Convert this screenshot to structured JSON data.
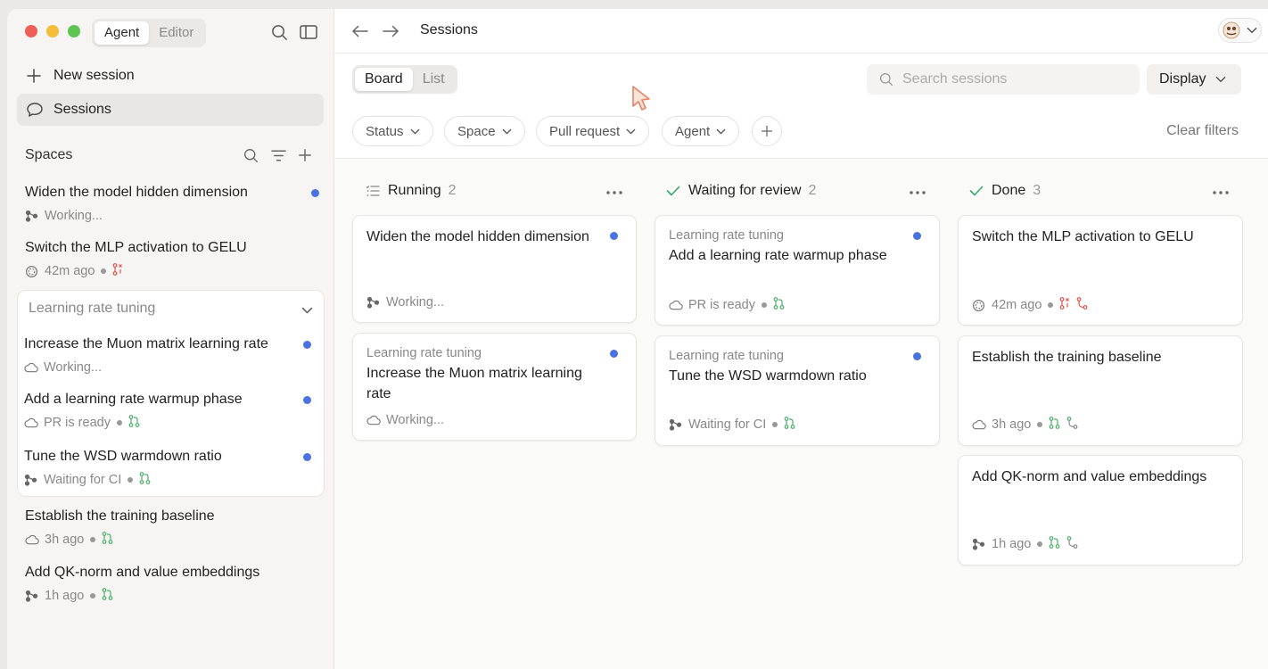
{
  "window": {
    "toggle": {
      "agent": "Agent",
      "editor": "Editor"
    }
  },
  "sidebar": {
    "new_session": "New session",
    "sessions": "Sessions",
    "spaces_title": "Spaces",
    "items_top": [
      {
        "title": "Widen the model hidden dimension",
        "meta": "Working...",
        "icon": "branch-icon",
        "unread": true
      },
      {
        "title": "Switch the MLP activation to GELU",
        "meta": "42m ago",
        "icon": "spinner-icon",
        "unread": false
      }
    ],
    "group": {
      "name": "Learning rate tuning",
      "items": [
        {
          "title": "Increase the Muon matrix learning rate",
          "meta": "Working...",
          "icon": "cloud-icon",
          "unread": true
        },
        {
          "title": "Add a learning rate warmup phase",
          "meta": "PR is ready",
          "icon": "cloud-icon",
          "unread": true
        },
        {
          "title": "Tune the WSD warmdown ratio",
          "meta": "Waiting for CI",
          "icon": "branch-icon",
          "unread": true
        }
      ]
    },
    "items_bottom": [
      {
        "title": "Establish the training baseline",
        "meta": "3h ago",
        "icon": "cloud-icon"
      },
      {
        "title": "Add QK-norm and value embeddings",
        "meta": "1h ago",
        "icon": "branch-icon"
      }
    ]
  },
  "header": {
    "title": "Sessions"
  },
  "toolbar": {
    "view": {
      "board": "Board",
      "list": "List"
    },
    "search_placeholder": "Search sessions",
    "display": "Display",
    "filters": [
      "Status",
      "Space",
      "Pull request",
      "Agent"
    ],
    "clear": "Clear filters"
  },
  "board": {
    "columns": [
      {
        "title": "Running",
        "count": "2",
        "cards": [
          {
            "title": "Widen the model hidden dimension",
            "meta": "Working..."
          },
          {
            "space": "Learning rate tuning",
            "title": "Increase the Muon matrix learning rate",
            "meta": "Working..."
          }
        ]
      },
      {
        "title": "Waiting for review",
        "count": "2",
        "cards": [
          {
            "space": "Learning rate tuning",
            "title": "Add a learning rate warmup phase",
            "meta": "PR is ready"
          },
          {
            "space": "Learning rate tuning",
            "title": "Tune the WSD warmdown ratio",
            "meta": "Waiting for CI"
          }
        ]
      },
      {
        "title": "Done",
        "count": "3",
        "cards": [
          {
            "title": "Switch the MLP activation to GELU",
            "meta": "42m ago"
          },
          {
            "title": "Establish the training baseline",
            "meta": "3h ago"
          },
          {
            "title": "Add QK-norm and value embeddings",
            "meta": "1h ago"
          }
        ]
      }
    ]
  },
  "colors": {
    "accent_dot": "#4a72e0",
    "pr_green": "#4caf6a",
    "pr_red": "#e0534a",
    "check_green": "#3aa66a"
  }
}
